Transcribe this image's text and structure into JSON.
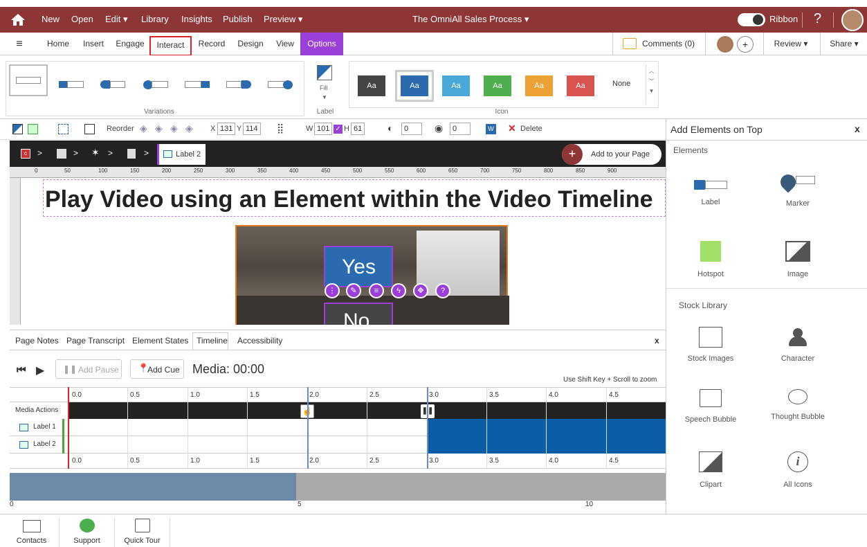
{
  "topbar": {
    "menu": [
      "New",
      "Open",
      "Edit ▾",
      "Library",
      "Insights",
      "Publish",
      "Preview ▾"
    ],
    "title": "The OmniAll Sales Process ▾",
    "ribbon_label": "Ribbon",
    "help": "?"
  },
  "tabs": [
    "Home",
    "Insert",
    "Engage",
    "Interact",
    "Record",
    "Design",
    "View",
    "Options"
  ],
  "tabbar_right": {
    "comments": "Comments (0)",
    "add": "+",
    "review": "Review ▾",
    "share": "Share ▾"
  },
  "ribbon": {
    "variations_label": "Variations",
    "label_group": "Label",
    "fill_label": "Fill",
    "icon_group": "Icon",
    "swatch_text": "Aa",
    "none_label": "None",
    "swatch_colors": [
      "#444444",
      "#2a6aae",
      "#4aa8d8",
      "#4cae4c",
      "#eea236",
      "#d9534f"
    ]
  },
  "toolbar": {
    "reorder": "Reorder",
    "x_label": "X",
    "x": "131",
    "y_label": "Y",
    "y": "114",
    "w_label": "W",
    "w": "101",
    "h_label": "H",
    "h": "61",
    "opacity": "0",
    "rotation": "0",
    "delete": "Delete"
  },
  "breadcrumb": {
    "current": "Label 2",
    "add_page": "Add to your Page"
  },
  "ruler_ticks": [
    "0",
    "50",
    "100",
    "150",
    "200",
    "250",
    "300",
    "350",
    "400",
    "450",
    "500",
    "550",
    "600",
    "650",
    "700",
    "750",
    "800",
    "850",
    "900"
  ],
  "canvas": {
    "heading": "Play Video using an Element within the Video Timeline",
    "yes": "Yes",
    "no": "No"
  },
  "bottom": {
    "tabs": [
      "Page Notes",
      "Page Transcript",
      "Element States",
      "Timeline",
      "Accessibility"
    ],
    "close": "x",
    "add_pause": "Add Pause",
    "add_cue": "Add Cue",
    "media": "Media: 00:00",
    "zoom_hint": "Use Shift Key + Scroll to zoom",
    "ticks": [
      "0.0",
      "0.5",
      "1.0",
      "1.5",
      "2.0",
      "2.5",
      "3.0",
      "3.5",
      "4.0",
      "4.5"
    ],
    "rows": [
      "Media Actions",
      "Label 1",
      "Label 2"
    ],
    "scroll_ticks": [
      "0",
      "5",
      "10"
    ]
  },
  "right_panel": {
    "title": "Add Elements on Top",
    "close": "x",
    "elements_header": "Elements",
    "elements": [
      "Label",
      "Marker",
      "Hotspot",
      "Image"
    ],
    "stock_header": "Stock Library",
    "stock": [
      "Stock Images",
      "Character",
      "Speech Bubble",
      "Thought Bubble",
      "Clipart",
      "All Icons"
    ]
  },
  "footer": [
    "Contacts",
    "Support",
    "Quick Tour"
  ],
  "colors": {
    "brand": "#8e3536",
    "accent": "#9b3fd9",
    "timeline_blue": "#0a5ea8"
  }
}
